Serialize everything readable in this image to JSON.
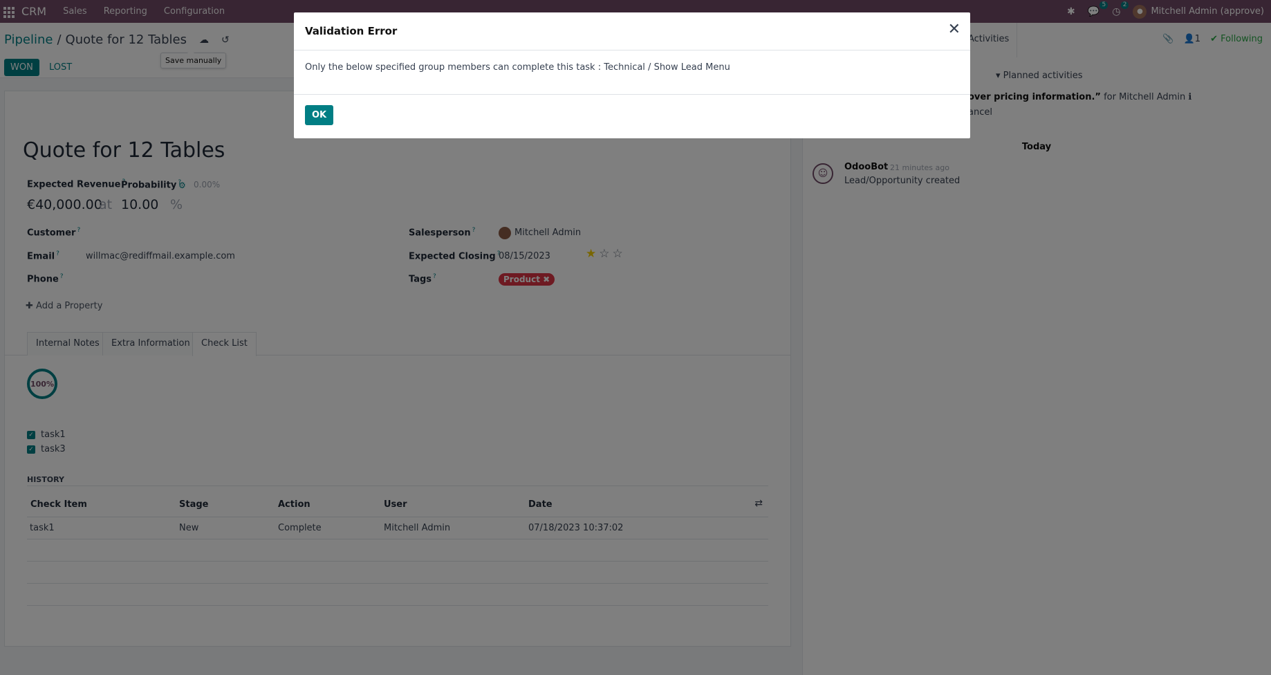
{
  "navbar": {
    "brand": "CRM",
    "menu": [
      "Sales",
      "Reporting",
      "Configuration"
    ],
    "messages_count": "5",
    "activities_count": "2",
    "user": "Mitchell Admin (approve)"
  },
  "control": {
    "breadcrumb_parent": "Pipeline",
    "breadcrumb_sep": "/",
    "breadcrumb_current": "Quote for 12 Tables",
    "tooltip": "Save manually",
    "won_label": "WON",
    "lost_label": "LOST"
  },
  "chatter_top": {
    "activities_label": "Activities",
    "followers_count": "1",
    "following_label": "Following"
  },
  "form": {
    "title": "Quote for 12 Tables",
    "expected_revenue_label": "Expected Revenue",
    "probability_label": "Probability",
    "probability_auto": "0.00%",
    "revenue_value": "€40,000.00",
    "at_label": "at",
    "probability_value": "10.00",
    "percent_sign": "%",
    "customer_label": "Customer",
    "email_label": "Email",
    "email_value": "willmac@rediffmail.example.com",
    "phone_label": "Phone",
    "salesperson_label": "Salesperson",
    "salesperson_value": "Mitchell Admin",
    "expected_closing_label": "Expected Closing",
    "expected_closing_value": "08/15/2023",
    "tags_label": "Tags",
    "tag_value": "Product",
    "add_property": "Add a Property",
    "help_mark": "?",
    "priority_stars": 1
  },
  "tabs": [
    "Internal Notes",
    "Extra Information",
    "Check List"
  ],
  "checklist": {
    "progress": "100%",
    "items": [
      "task1",
      "task3"
    ],
    "history_title": "HISTORY",
    "columns": [
      "Check Item",
      "Stage",
      "Action",
      "User",
      "Date"
    ],
    "rows": [
      {
        "item": "task1",
        "stage": "New",
        "action": "Complete",
        "user": "Mitchell Admin",
        "date": "07/18/2023 10:37:02"
      }
    ]
  },
  "chatter": {
    "planned_activities": "Planned activities",
    "activity_text": "over pricing information.”",
    "activity_for": "for Mitchell Admin",
    "activity_cancel": "ancel",
    "today_label": "Today",
    "author": "OdooBot",
    "time": "· 21 minutes ago",
    "message": "Lead/Opportunity created"
  },
  "modal": {
    "title": "Validation Error",
    "message": "Only the below specified group members can complete this task : Technical / Show Lead Menu",
    "ok_label": "OK"
  },
  "colors": {
    "brand": "#714b67",
    "accent": "#017e84",
    "tag": "#dc3545",
    "following": "#28a745"
  }
}
